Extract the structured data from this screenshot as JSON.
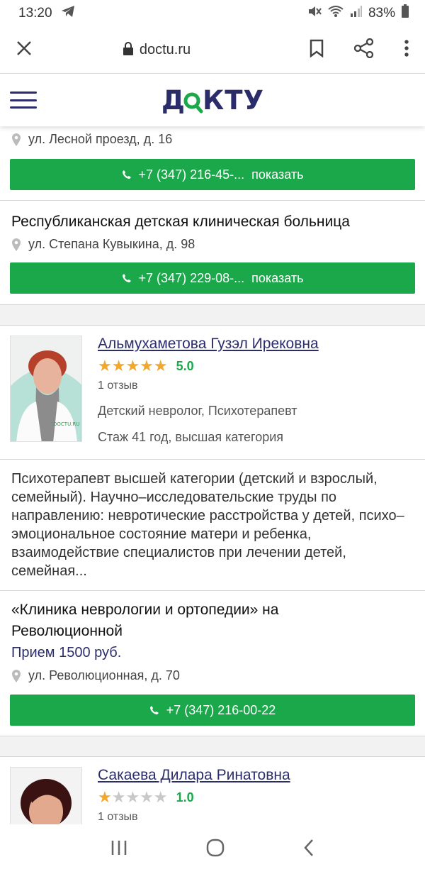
{
  "status": {
    "time": "13:20",
    "battery": "83%"
  },
  "browser": {
    "url": "doctu.ru"
  },
  "site": {
    "logo": "ДОКТУ"
  },
  "clinics_top": {
    "address": "ул. Лесной проезд, д. 16",
    "phone": "+7 (347) 216-45-...",
    "show_label": "показать"
  },
  "clinic2": {
    "name": "Республиканская детская клиническая больница",
    "address": "ул. Степана Кувыкина, д. 98",
    "phone": "+7 (347) 229-08-...",
    "show_label": "показать"
  },
  "doctor1": {
    "name": "Альмухаметова Гузэл Ирековна",
    "rating_value": 5,
    "score": "5.0",
    "reviews": "1 отзыв",
    "specialty": "Детский невролог, Психотерапевт",
    "experience": "Стаж 41 год, высшая категория",
    "description": "Психотерапевт высшей категории (детский и взрослый, семейный). Научно–исследовательские труды по направлению: невротические расстройства у детей, психо–эмоциональное состояние матери и ребенка, взаимодействие специалистов при лечении детей, семейная...",
    "clinic_name": "«Клиника неврологии и ортопедии» на Революционной",
    "price": "Прием 1500 руб.",
    "clinic_address": "ул. Революционная, д. 70",
    "clinic_phone": "+7 (347) 216-00-22"
  },
  "doctor2": {
    "name": "Сакаева Дилара Ринатовна",
    "rating_value": 1,
    "score": "1.0",
    "reviews": "1 отзыв"
  },
  "colors": {
    "brand_green": "#1ba84a",
    "brand_navy": "#2b2d6b",
    "star": "#f0a82e"
  }
}
